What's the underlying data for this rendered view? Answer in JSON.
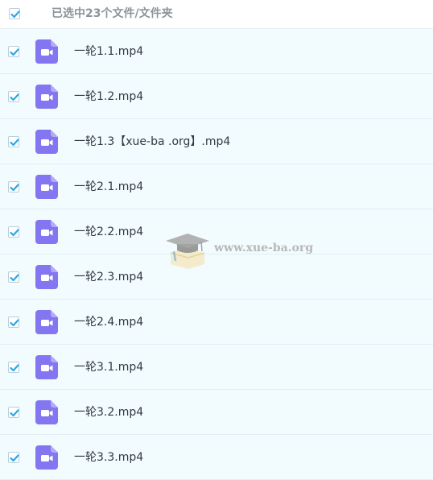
{
  "header": {
    "selection_label": "已选中23个文件/文件夹",
    "select_all_checked": true
  },
  "files": [
    {
      "name": "一轮1.1.mp4",
      "checked": true
    },
    {
      "name": "一轮1.2.mp4",
      "checked": true
    },
    {
      "name": "一轮1.3【xue-ba .org】.mp4",
      "checked": true
    },
    {
      "name": "一轮2.1.mp4",
      "checked": true
    },
    {
      "name": "一轮2.2.mp4",
      "checked": true
    },
    {
      "name": "一轮2.3.mp4",
      "checked": true
    },
    {
      "name": "一轮2.4.mp4",
      "checked": true
    },
    {
      "name": "一轮3.1.mp4",
      "checked": true
    },
    {
      "name": "一轮3.2.mp4",
      "checked": true
    },
    {
      "name": "一轮3.3.mp4",
      "checked": true
    }
  ],
  "watermark": {
    "text": "www.xue-ba.org",
    "icon": "graduation-cap-icon"
  },
  "colors": {
    "check": "#2aa7e6",
    "video_icon": "#8376f0",
    "row_bg": "#f2fbfe"
  },
  "icons": {
    "checkbox": "checkmark-icon",
    "file": "video-file-icon"
  }
}
